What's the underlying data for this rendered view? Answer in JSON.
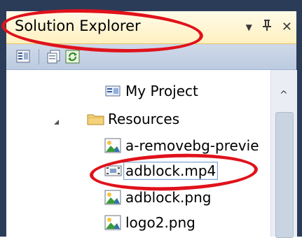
{
  "panel": {
    "title": "Solution Explorer",
    "controls": {
      "dropdown": "▼",
      "pin": "ᵽ",
      "close": "✕"
    }
  },
  "toolbar": {
    "icons": [
      "properties-icon",
      "show-all-files-icon",
      "refresh-icon"
    ]
  },
  "tree": {
    "items": [
      {
        "label": "My Project",
        "icon": "my-project-icon",
        "expanded": null
      },
      {
        "label": "Resources",
        "icon": "folder-icon",
        "expanded": true
      },
      {
        "label": "a-removebg-previe",
        "icon": "image-file-icon"
      },
      {
        "label": "adblock.mp4",
        "icon": "video-file-icon",
        "selected": true
      },
      {
        "label": "adblock.png",
        "icon": "image-file-icon"
      },
      {
        "label": "logo2.png",
        "icon": "image-file-icon"
      }
    ]
  },
  "scrollbar": {
    "up_arrow": "^"
  },
  "colors": {
    "annotation": "#e0121b",
    "chrome": "#2b3c59",
    "title_bg": "#fff0c0"
  }
}
